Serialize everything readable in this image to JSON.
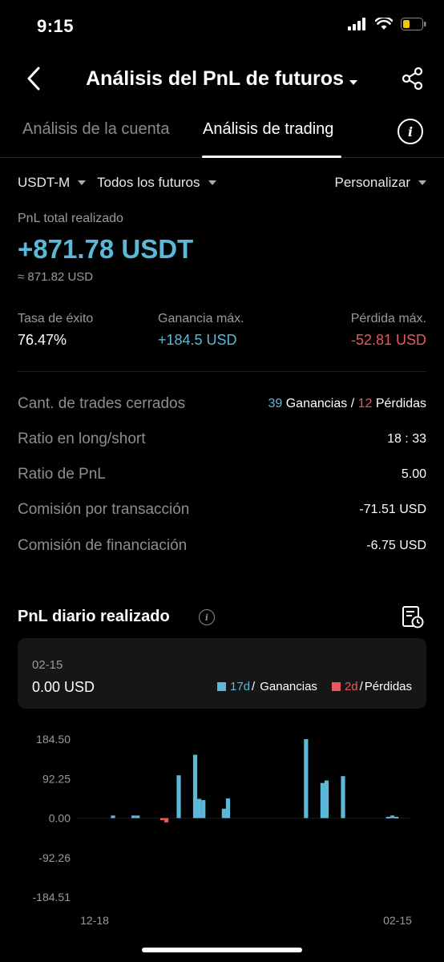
{
  "status_bar": {
    "time": "9:15"
  },
  "header": {
    "title": "Análisis del PnL de futuros"
  },
  "tabs": [
    {
      "label": "Análisis de la cuenta",
      "active": false
    },
    {
      "label": "Análisis de trading",
      "active": true
    }
  ],
  "filters": {
    "margin": "USDT-M",
    "scope": "Todos los futuros",
    "custom": "Personalizar"
  },
  "pnl": {
    "label": "PnL total realizado",
    "value": "+871.78 USDT",
    "approx": "≈ 871.82 USD"
  },
  "stats": [
    {
      "label": "Tasa de éxito",
      "value": "76.47%"
    },
    {
      "label": "Ganancia máx.",
      "value": "+184.5 USD"
    },
    {
      "label": "Pérdida máx.",
      "value": "-52.81 USD"
    }
  ],
  "details": {
    "closed_trades": {
      "label": "Cant. de trades cerrados",
      "wins": "39",
      "wins_label": "Ganancias",
      "sep": "/",
      "losses": "12",
      "losses_label": "Pérdidas"
    },
    "long_short": {
      "label": "Ratio en long/short",
      "value": "18 : 33"
    },
    "pnl_ratio": {
      "label": "Ratio de PnL",
      "value": "5.00"
    },
    "fee": {
      "label": "Comisión por transacción",
      "value": "-71.51 USD"
    },
    "funding": {
      "label": "Comisión de financiación",
      "value": "-6.75 USD"
    }
  },
  "daily": {
    "title": "PnL diario realizado",
    "card": {
      "date": "02-15",
      "value": "0.00 USD",
      "wins_days": "17d",
      "wins_label": "Ganancias",
      "losses_days": "2d",
      "losses_label": "Pérdidas",
      "sep": "/"
    }
  },
  "colors": {
    "positive": "#5bb8d8",
    "negative": "#e8585c",
    "background": "#000000"
  },
  "chart_data": {
    "type": "bar",
    "yticks": [
      "184.50",
      "92.25",
      "0.00",
      "-92.26",
      "-184.51"
    ],
    "ylim": [
      -184.51,
      184.5
    ],
    "xtick_labels": [
      "12-18",
      "02-15"
    ],
    "values": [
      0,
      0,
      0,
      0,
      0,
      0,
      0,
      0,
      6,
      0,
      0,
      0,
      0,
      6,
      6,
      0,
      0,
      0,
      0,
      0,
      -5,
      -10,
      0,
      0,
      100,
      0,
      0,
      0,
      148,
      45,
      42,
      0,
      0,
      0,
      0,
      22,
      46,
      0,
      0,
      0,
      0,
      0,
      0,
      0,
      0,
      0,
      0,
      0,
      0,
      0,
      0,
      0,
      0,
      0,
      0,
      184.5,
      0,
      0,
      0,
      82,
      88,
      0,
      0,
      0,
      98,
      0,
      0,
      0,
      0,
      0,
      0,
      0,
      0,
      0,
      0,
      3,
      6,
      3,
      0,
      0,
      0
    ]
  }
}
